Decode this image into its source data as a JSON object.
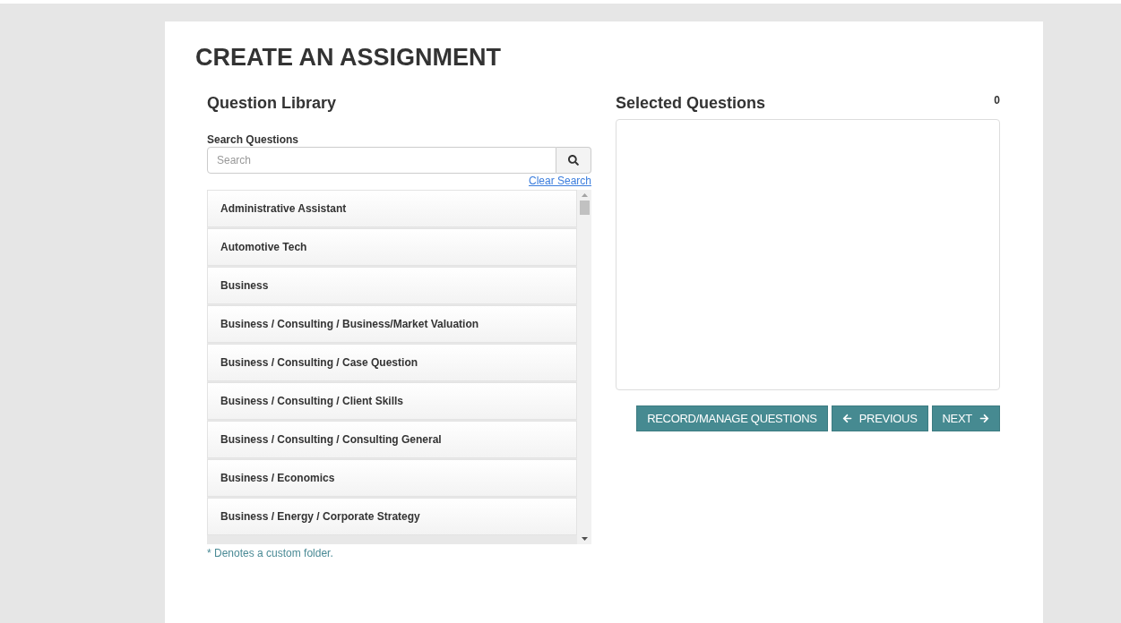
{
  "page_title": "CREATE AN ASSIGNMENT",
  "library": {
    "title": "Question Library",
    "search_label": "Search Questions",
    "search": {
      "placeholder": "Search"
    },
    "clear_link": "Clear Search",
    "items": [
      {
        "label": "Administrative Assistant"
      },
      {
        "label": "Automotive Tech"
      },
      {
        "label": "Business"
      },
      {
        "label": "Business / Consulting / Business/Market Valuation"
      },
      {
        "label": "Business / Consulting / Case Question"
      },
      {
        "label": "Business / Consulting / Client Skills"
      },
      {
        "label": "Business / Consulting / Consulting General"
      },
      {
        "label": "Business / Economics"
      },
      {
        "label": "Business / Energy / Corporate Strategy"
      }
    ],
    "footnote": "* Denotes a custom folder."
  },
  "selected": {
    "title": "Selected Questions",
    "count": "0"
  },
  "buttons": [
    {
      "label": "RECORD/MANAGE QUESTIONS",
      "kind": "plain"
    },
    {
      "label": "PREVIOUS",
      "kind": "back"
    },
    {
      "label": "NEXT",
      "kind": "forward"
    }
  ]
}
